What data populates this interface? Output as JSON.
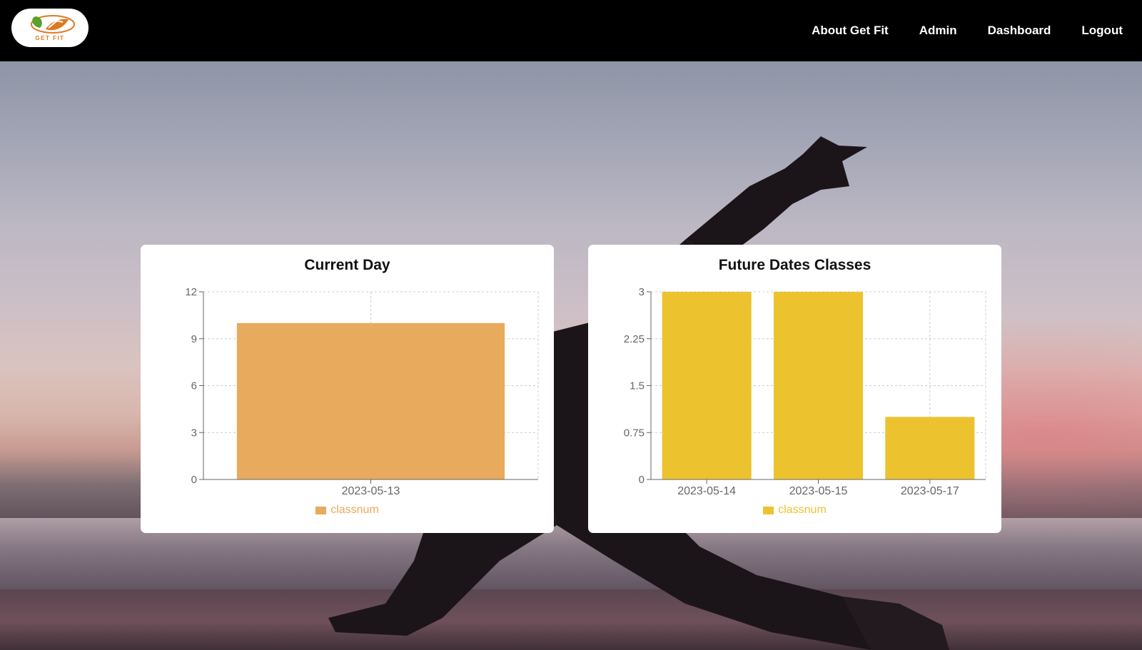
{
  "navbar": {
    "logo_text": "GET FIT",
    "links": [
      {
        "label": "About Get Fit"
      },
      {
        "label": "Admin"
      },
      {
        "label": "Dashboard"
      },
      {
        "label": "Logout"
      }
    ]
  },
  "chart_data": [
    {
      "type": "bar",
      "title": "Current Day",
      "categories": [
        "2023-05-13"
      ],
      "series": [
        {
          "name": "classnum",
          "values": [
            10
          ]
        }
      ],
      "ylim": [
        0,
        12
      ],
      "yticks": [
        "0",
        "3",
        "6",
        "9",
        "12"
      ],
      "ytick_values": [
        0,
        3,
        6,
        9,
        12
      ],
      "grid": true,
      "legend": "bottom",
      "color": "#e8aa5c"
    },
    {
      "type": "bar",
      "title": "Future Dates Classes",
      "categories": [
        "2023-05-14",
        "2023-05-15",
        "2023-05-17"
      ],
      "series": [
        {
          "name": "classnum",
          "values": [
            3,
            3,
            1
          ]
        }
      ],
      "ylim": [
        0,
        3
      ],
      "yticks": [
        "0",
        "0.75",
        "1.5",
        "2.25",
        "3"
      ],
      "ytick_values": [
        0,
        0.75,
        1.5,
        2.25,
        3
      ],
      "grid": true,
      "legend": "bottom",
      "color": "#edc22f"
    }
  ]
}
